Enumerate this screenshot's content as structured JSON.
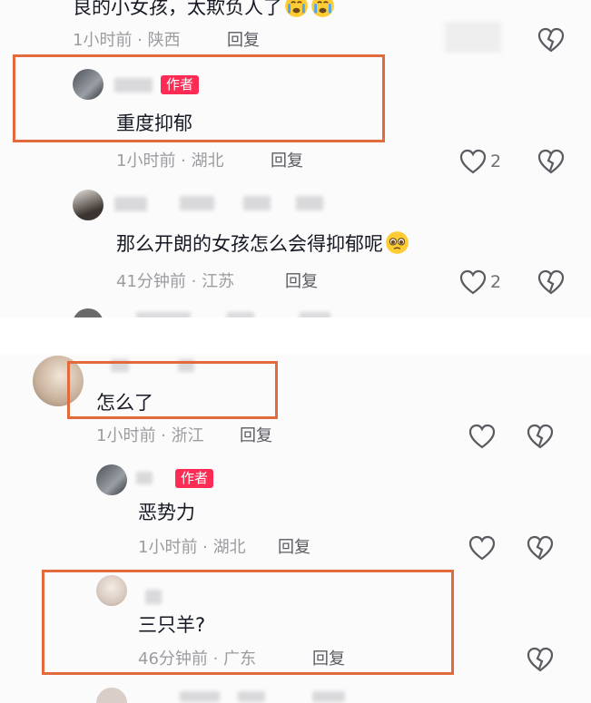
{
  "comments": [
    {
      "text": "良的小女孩，太欺负人了",
      "meta": "1小时前 · 陕西",
      "reply": "回复"
    },
    {
      "badge": "作者",
      "text": "重度抑郁",
      "meta": "1小时前 · 湖北",
      "reply": "回复",
      "likes": "2"
    },
    {
      "text": "那么开朗的女孩怎么会得抑郁呢",
      "meta": "41分钟前 · 江苏",
      "reply": "回复",
      "likes": "2"
    },
    {
      "text": "怎么了",
      "meta": "1小时前 · 浙江",
      "reply": "回复"
    },
    {
      "badge": "作者",
      "text": "恶势力",
      "meta": "1小时前 · 湖北",
      "reply": "回复"
    },
    {
      "text": "三只羊?",
      "meta": "46分钟前 · 广东",
      "reply": "回复"
    }
  ],
  "icons": {
    "like": "heart-outline-icon",
    "dislike": "broken-heart-icon",
    "emoji_sad": "crying-face-emoji",
    "emoji_plead": "pleading-face-emoji"
  },
  "colors": {
    "author_badge": "#fe2c55",
    "highlight_box": "#e36a3d"
  }
}
